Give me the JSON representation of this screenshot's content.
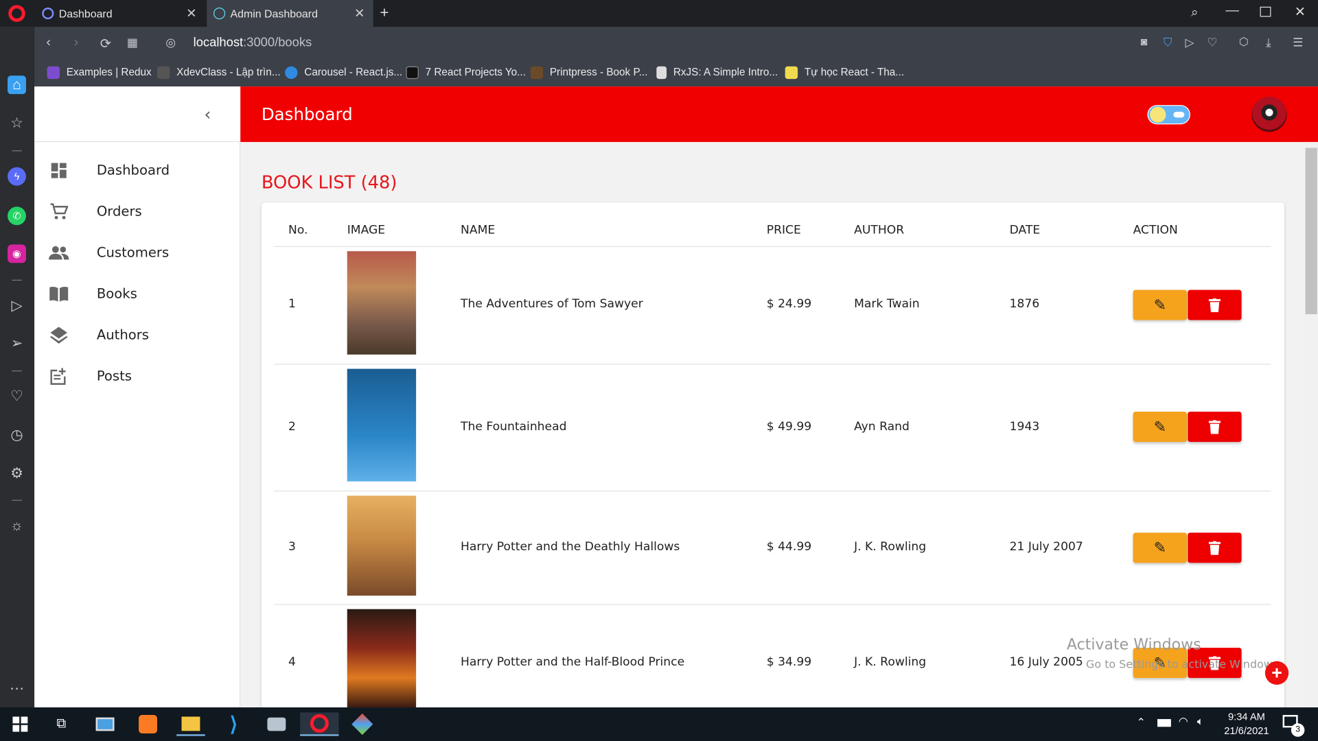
{
  "browser": {
    "tabs": [
      {
        "label": "Dashboard"
      },
      {
        "label": "Admin Dashboard"
      }
    ],
    "url_host": "localhost",
    "url_path": ":3000/books",
    "bookmarks": [
      {
        "label": "Examples | Redux",
        "color": "#7c4dce"
      },
      {
        "label": "XdevClass - Lập trìn...",
        "color": "#555555"
      },
      {
        "label": "Carousel - React.js...",
        "color": "#2f8ae0"
      },
      {
        "label": "7 React Projects Yo...",
        "color": "#111111"
      },
      {
        "label": "Printpress - Book P...",
        "color": "#6b4a2a"
      },
      {
        "label": "RxJS: A Simple Intro...",
        "color": "#dddddd"
      },
      {
        "label": "Tự học React - Tha...",
        "color": "#f0db4f"
      }
    ]
  },
  "app": {
    "title": "Dashboard",
    "nav": [
      {
        "label": "Dashboard",
        "icon": "dashboard-icon"
      },
      {
        "label": "Orders",
        "icon": "cart-icon"
      },
      {
        "label": "Customers",
        "icon": "people-icon"
      },
      {
        "label": "Books",
        "icon": "book-icon"
      },
      {
        "label": "Authors",
        "icon": "layers-icon"
      },
      {
        "label": "Posts",
        "icon": "post-add-icon"
      }
    ],
    "page_heading": "BOOK LIST (48)",
    "table": {
      "headers": [
        "No.",
        "IMAGE",
        "NAME",
        "PRICE",
        "AUTHOR",
        "DATE",
        "ACTION"
      ],
      "rows": [
        {
          "no": "1",
          "name": "The Adventures of Tom Sawyer",
          "price": "$ 24.99",
          "author": "Mark Twain",
          "date": "1876",
          "cover_color": "#8a6a5a"
        },
        {
          "no": "2",
          "name": "The Fountainhead",
          "price": "$ 49.99",
          "author": "Ayn Rand",
          "date": "1943",
          "cover_color": "#1f6fa8"
        },
        {
          "no": "3",
          "name": "Harry Potter and the Deathly Hallows",
          "price": "$ 44.99",
          "author": "J. K. Rowling",
          "date": "21 July 2007",
          "cover_color": "#c27a35"
        },
        {
          "no": "4",
          "name": "Harry Potter and the Half-Blood Prince",
          "price": "$ 34.99",
          "author": "J. K. Rowling",
          "date": "16 July 2005",
          "cover_color": "#8b2a1a"
        }
      ]
    },
    "accent_color": "#f00000",
    "edit_color": "#f5a21d",
    "delete_color": "#ee0000"
  },
  "watermark": {
    "line1": "Activate Windows",
    "line2": "Go to Settings to activate Windows."
  },
  "taskbar": {
    "time": "9:34 AM",
    "date": "21/6/2021",
    "notif_count": "3"
  }
}
